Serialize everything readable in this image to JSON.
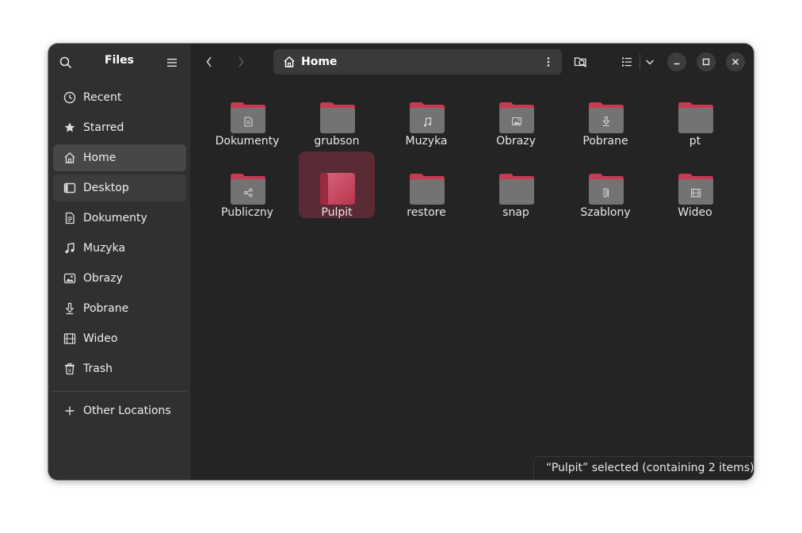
{
  "app": {
    "title": "Files"
  },
  "sidebar": {
    "items": [
      {
        "label": "Recent",
        "icon": "clock-icon"
      },
      {
        "label": "Starred",
        "icon": "star-icon"
      },
      {
        "label": "Home",
        "icon": "home-icon"
      },
      {
        "label": "Desktop",
        "icon": "desktop-icon"
      },
      {
        "label": "Dokumenty",
        "icon": "document-icon"
      },
      {
        "label": "Muzyka",
        "icon": "music-icon"
      },
      {
        "label": "Obrazy",
        "icon": "image-icon"
      },
      {
        "label": "Pobrane",
        "icon": "download-icon"
      },
      {
        "label": "Wideo",
        "icon": "video-icon"
      },
      {
        "label": "Trash",
        "icon": "trash-icon"
      }
    ],
    "other_locations": "Other Locations"
  },
  "header": {
    "path": "Home"
  },
  "files": [
    {
      "name": "Dokumenty",
      "emblem": "document"
    },
    {
      "name": "grubson",
      "emblem": ""
    },
    {
      "name": "Muzyka",
      "emblem": "music"
    },
    {
      "name": "Obrazy",
      "emblem": "image"
    },
    {
      "name": "Pobrane",
      "emblem": "download"
    },
    {
      "name": "pt",
      "emblem": ""
    },
    {
      "name": "Publiczny",
      "emblem": "share"
    },
    {
      "name": "Pulpit",
      "emblem": "desktop"
    },
    {
      "name": "restore",
      "emblem": ""
    },
    {
      "name": "snap",
      "emblem": ""
    },
    {
      "name": "Szablony",
      "emblem": "template"
    },
    {
      "name": "Wideo",
      "emblem": "video"
    }
  ],
  "status": "“Pulpit” selected  (containing 2 items)",
  "colors": {
    "accent": "#c83a52",
    "folder_body": "#737373",
    "sidebar_bg": "#303030",
    "main_bg": "#242424",
    "selection": "#5a2a35"
  }
}
